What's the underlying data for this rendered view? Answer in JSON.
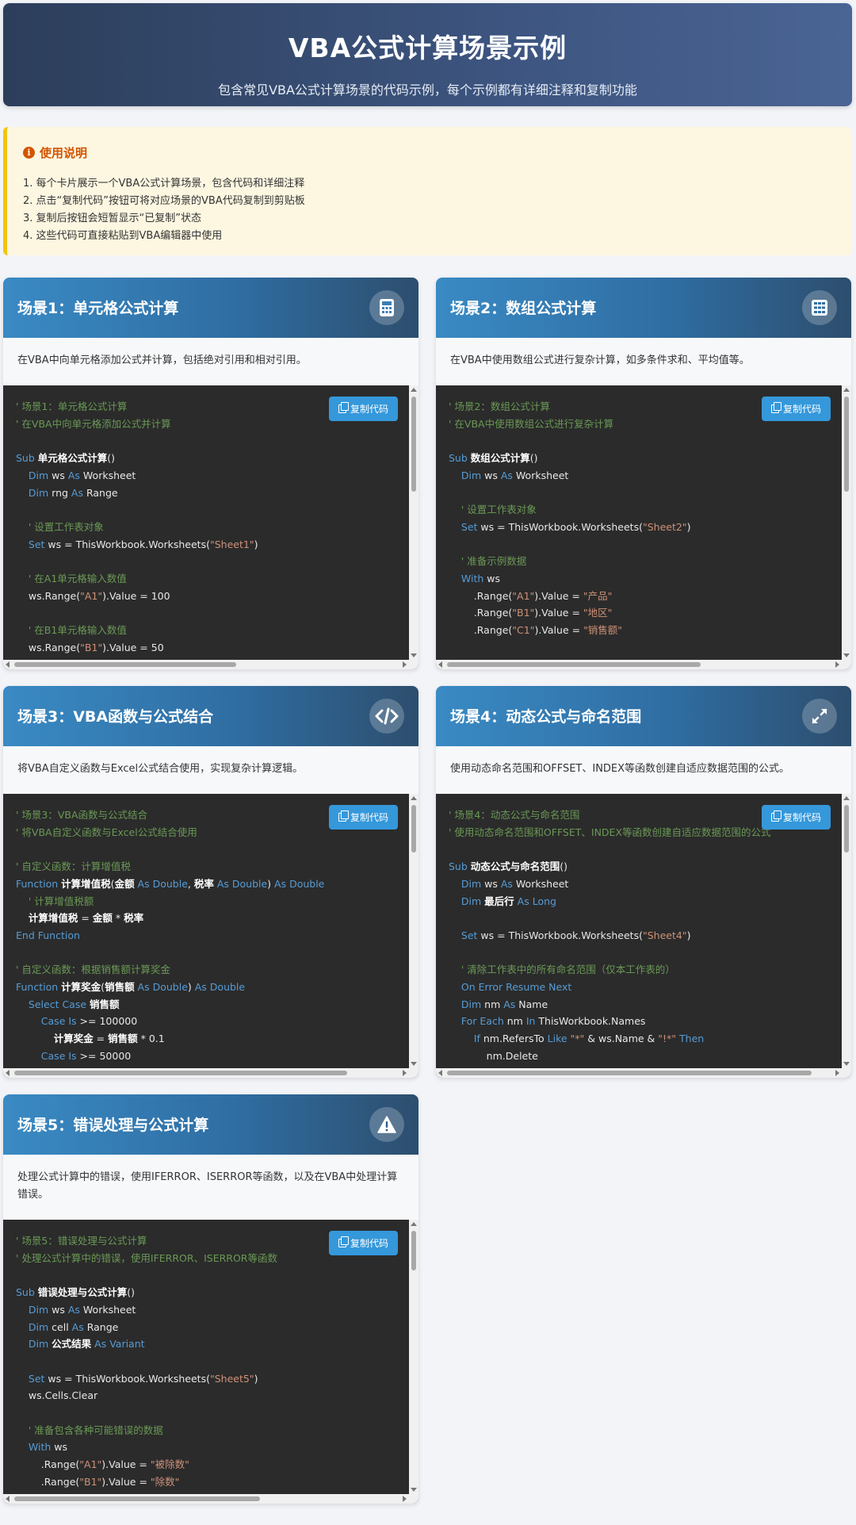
{
  "header": {
    "title": "VBA公式计算场景示例",
    "subtitle": "包含常见VBA公式计算场景的代码示例，每个示例都有详细注释和复制功能"
  },
  "usage": {
    "title": "使用说明",
    "items": [
      "1. 每个卡片展示一个VBA公式计算场景，包含代码和详细注释",
      "2. 点击“复制代码”按钮可将对应场景的VBA代码复制到剪贴板",
      "3. 复制后按钮会短暂显示“已复制”状态",
      "4. 这些代码可直接粘贴到VBA编辑器中使用"
    ]
  },
  "copy_label": "复制代码",
  "colors": {
    "accent": "#3498db",
    "header_bg": "#3d5580",
    "code_bg": "#2b2b2b",
    "comment": "#6a9955",
    "keyword": "#569cd6",
    "string": "#ce9178",
    "warning": "#f1c40f"
  },
  "cards": [
    {
      "title": "场景1：单元格公式计算",
      "icon": "calculator-icon",
      "desc": "在VBA中向单元格添加公式并计算，包括绝对引用和相对引用。",
      "lines": [
        [
          [
            "cm",
            "' 场景1：单元格公式计算"
          ]
        ],
        [
          [
            "cm",
            "' 在VBA中向单元格添加公式并计算"
          ]
        ],
        [],
        [
          [
            "kw",
            "Sub "
          ],
          [
            "fn",
            "单元格公式计算"
          ],
          [
            "",
            "()"
          ]
        ],
        [
          [
            "",
            "    "
          ],
          [
            "kw",
            "Dim"
          ],
          [
            "",
            " ws "
          ],
          [
            "kw",
            "As"
          ],
          [
            "",
            " Worksheet"
          ]
        ],
        [
          [
            "",
            "    "
          ],
          [
            "kw",
            "Dim"
          ],
          [
            "",
            " rng "
          ],
          [
            "kw",
            "As"
          ],
          [
            "",
            " Range"
          ]
        ],
        [],
        [
          [
            "cm",
            "    ' 设置工作表对象"
          ]
        ],
        [
          [
            "",
            "    "
          ],
          [
            "kw",
            "Set"
          ],
          [
            "",
            " ws = ThisWorkbook.Worksheets("
          ],
          [
            "st",
            "\"Sheet1\""
          ],
          [
            "",
            ")"
          ]
        ],
        [],
        [
          [
            "cm",
            "    ' 在A1单元格输入数值"
          ]
        ],
        [
          [
            "",
            "    ws.Range("
          ],
          [
            "st",
            "\"A1\""
          ],
          [
            "",
            ").Value = 100"
          ]
        ],
        [],
        [
          [
            "cm",
            "    ' 在B1单元格输入数值"
          ]
        ],
        [
          [
            "",
            "    ws.Range("
          ],
          [
            "st",
            "\"B1\""
          ],
          [
            "",
            ").Value = 50"
          ]
        ]
      ]
    },
    {
      "title": "场景2：数组公式计算",
      "icon": "grid-calculator-icon",
      "desc": "在VBA中使用数组公式进行复杂计算，如多条件求和、平均值等。",
      "lines": [
        [
          [
            "cm",
            "' 场景2：数组公式计算"
          ]
        ],
        [
          [
            "cm",
            "' 在VBA中使用数组公式进行复杂计算"
          ]
        ],
        [],
        [
          [
            "kw",
            "Sub "
          ],
          [
            "fn",
            "数组公式计算"
          ],
          [
            "",
            "()"
          ]
        ],
        [
          [
            "",
            "    "
          ],
          [
            "kw",
            "Dim"
          ],
          [
            "",
            " ws "
          ],
          [
            "kw",
            "As"
          ],
          [
            "",
            " Worksheet"
          ]
        ],
        [],
        [
          [
            "cm",
            "    ' 设置工作表对象"
          ]
        ],
        [
          [
            "",
            "    "
          ],
          [
            "kw",
            "Set"
          ],
          [
            "",
            " ws = ThisWorkbook.Worksheets("
          ],
          [
            "st",
            "\"Sheet2\""
          ],
          [
            "",
            ")"
          ]
        ],
        [],
        [
          [
            "cm",
            "    ' 准备示例数据"
          ]
        ],
        [
          [
            "",
            "    "
          ],
          [
            "kw",
            "With"
          ],
          [
            "",
            " ws"
          ]
        ],
        [
          [
            "",
            "        .Range("
          ],
          [
            "st",
            "\"A1\""
          ],
          [
            "",
            ").Value = "
          ],
          [
            "st",
            "\"产品\""
          ]
        ],
        [
          [
            "",
            "        .Range("
          ],
          [
            "st",
            "\"B1\""
          ],
          [
            "",
            ").Value = "
          ],
          [
            "st",
            "\"地区\""
          ]
        ],
        [
          [
            "",
            "        .Range("
          ],
          [
            "st",
            "\"C1\""
          ],
          [
            "",
            ").Value = "
          ],
          [
            "st",
            "\"销售额\""
          ]
        ]
      ]
    },
    {
      "title": "场景3：VBA函数与公式结合",
      "icon": "code-icon",
      "desc": "将VBA自定义函数与Excel公式结合使用，实现复杂计算逻辑。",
      "lines": [
        [
          [
            "cm",
            "' 场景3：VBA函数与公式结合"
          ]
        ],
        [
          [
            "cm",
            "' 将VBA自定义函数与Excel公式结合使用"
          ]
        ],
        [],
        [
          [
            "cm",
            "' 自定义函数：计算增值税"
          ]
        ],
        [
          [
            "kw",
            "Function "
          ],
          [
            "fn",
            "计算增值税"
          ],
          [
            "",
            "("
          ],
          [
            "fn",
            "金额"
          ],
          [
            "kw",
            " As Double"
          ],
          [
            "",
            ", "
          ],
          [
            "fn",
            "税率"
          ],
          [
            "kw",
            " As Double"
          ],
          [
            "",
            ")"
          ],
          [
            "kw",
            " As Double"
          ]
        ],
        [
          [
            "cm",
            "    ' 计算增值税额"
          ]
        ],
        [
          [
            "",
            "    "
          ],
          [
            "fn",
            "计算增值税"
          ],
          [
            "",
            " = "
          ],
          [
            "fn",
            "金额"
          ],
          [
            "",
            " * "
          ],
          [
            "fn",
            "税率"
          ]
        ],
        [
          [
            "kw",
            "End Function"
          ]
        ],
        [],
        [
          [
            "cm",
            "' 自定义函数：根据销售额计算奖金"
          ]
        ],
        [
          [
            "kw",
            "Function "
          ],
          [
            "fn",
            "计算奖金"
          ],
          [
            "",
            "("
          ],
          [
            "fn",
            "销售额"
          ],
          [
            "kw",
            " As Double"
          ],
          [
            "",
            ")"
          ],
          [
            "kw",
            " As Double"
          ]
        ],
        [
          [
            "",
            "    "
          ],
          [
            "kw",
            "Select Case"
          ],
          [
            "",
            " "
          ],
          [
            "fn",
            "销售额"
          ]
        ],
        [
          [
            "",
            "        "
          ],
          [
            "kw",
            "Case Is"
          ],
          [
            "",
            " >= 100000"
          ]
        ],
        [
          [
            "",
            "            "
          ],
          [
            "fn",
            "计算奖金"
          ],
          [
            "",
            " = "
          ],
          [
            "fn",
            "销售额"
          ],
          [
            "",
            " * 0.1"
          ]
        ],
        [
          [
            "",
            "        "
          ],
          [
            "kw",
            "Case Is"
          ],
          [
            "",
            " >= 50000"
          ]
        ]
      ]
    },
    {
      "title": "场景4：动态公式与命名范围",
      "icon": "expand-icon",
      "desc": "使用动态命名范围和OFFSET、INDEX等函数创建自适应数据范围的公式。",
      "lines": [
        [
          [
            "cm",
            "' 场景4：动态公式与命名范围"
          ]
        ],
        [
          [
            "cm",
            "' 使用动态命名范围和OFFSET、INDEX等函数创建自适应数据范围的公式"
          ]
        ],
        [],
        [
          [
            "kw",
            "Sub "
          ],
          [
            "fn",
            "动态公式与命名范围"
          ],
          [
            "",
            "()"
          ]
        ],
        [
          [
            "",
            "    "
          ],
          [
            "kw",
            "Dim"
          ],
          [
            "",
            " ws "
          ],
          [
            "kw",
            "As"
          ],
          [
            "",
            " Worksheet"
          ]
        ],
        [
          [
            "",
            "    "
          ],
          [
            "kw",
            "Dim"
          ],
          [
            "",
            " "
          ],
          [
            "fn",
            "最后行"
          ],
          [
            "kw",
            " As Long"
          ]
        ],
        [],
        [
          [
            "",
            "    "
          ],
          [
            "kw",
            "Set"
          ],
          [
            "",
            " ws = ThisWorkbook.Worksheets("
          ],
          [
            "st",
            "\"Sheet4\""
          ],
          [
            "",
            ")"
          ]
        ],
        [],
        [
          [
            "cm",
            "    ' 清除工作表中的所有命名范围（仅本工作表的）"
          ]
        ],
        [
          [
            "",
            "    "
          ],
          [
            "kw",
            "On Error Resume Next"
          ]
        ],
        [
          [
            "",
            "    "
          ],
          [
            "kw",
            "Dim"
          ],
          [
            "",
            " nm "
          ],
          [
            "kw",
            "As"
          ],
          [
            "",
            " Name"
          ]
        ],
        [
          [
            "",
            "    "
          ],
          [
            "kw",
            "For Each"
          ],
          [
            "",
            " nm "
          ],
          [
            "kw",
            "In"
          ],
          [
            "",
            " ThisWorkbook.Names"
          ]
        ],
        [
          [
            "",
            "        "
          ],
          [
            "kw",
            "If"
          ],
          [
            "",
            " nm.RefersTo "
          ],
          [
            "kw",
            "Like"
          ],
          [
            "",
            " "
          ],
          [
            "st",
            "\"*\""
          ],
          [
            "",
            " & ws.Name & "
          ],
          [
            "st",
            "\"!*\""
          ],
          [
            "kw",
            " Then"
          ]
        ],
        [
          [
            "",
            "            nm.Delete"
          ]
        ]
      ]
    },
    {
      "title": "场景5：错误处理与公式计算",
      "icon": "warning-icon",
      "desc": "处理公式计算中的错误，使用IFERROR、ISERROR等函数，以及在VBA中处理计算错误。",
      "lines": [
        [
          [
            "cm",
            "' 场景5：错误处理与公式计算"
          ]
        ],
        [
          [
            "cm",
            "' 处理公式计算中的错误，使用IFERROR、ISERROR等函数"
          ]
        ],
        [],
        [
          [
            "kw",
            "Sub "
          ],
          [
            "fn",
            "错误处理与公式计算"
          ],
          [
            "",
            "()"
          ]
        ],
        [
          [
            "",
            "    "
          ],
          [
            "kw",
            "Dim"
          ],
          [
            "",
            " ws "
          ],
          [
            "kw",
            "As"
          ],
          [
            "",
            " Worksheet"
          ]
        ],
        [
          [
            "",
            "    "
          ],
          [
            "kw",
            "Dim"
          ],
          [
            "",
            " cell "
          ],
          [
            "kw",
            "As"
          ],
          [
            "",
            " Range"
          ]
        ],
        [
          [
            "",
            "    "
          ],
          [
            "kw",
            "Dim"
          ],
          [
            "",
            " "
          ],
          [
            "fn",
            "公式结果"
          ],
          [
            "kw",
            " As Variant"
          ]
        ],
        [],
        [
          [
            "",
            "    "
          ],
          [
            "kw",
            "Set"
          ],
          [
            "",
            " ws = ThisWorkbook.Worksheets("
          ],
          [
            "st",
            "\"Sheet5\""
          ],
          [
            "",
            ")"
          ]
        ],
        [
          [
            "",
            "    ws.Cells.Clear"
          ]
        ],
        [],
        [
          [
            "cm",
            "    ' 准备包含各种可能错误的数据"
          ]
        ],
        [
          [
            "",
            "    "
          ],
          [
            "kw",
            "With"
          ],
          [
            "",
            " ws"
          ]
        ],
        [
          [
            "",
            "        .Range("
          ],
          [
            "st",
            "\"A1\""
          ],
          [
            "",
            ").Value = "
          ],
          [
            "st",
            "\"被除数\""
          ]
        ],
        [
          [
            "",
            "        .Range("
          ],
          [
            "st",
            "\"B1\""
          ],
          [
            "",
            ").Value = "
          ],
          [
            "st",
            "\"除数\""
          ]
        ]
      ]
    }
  ]
}
